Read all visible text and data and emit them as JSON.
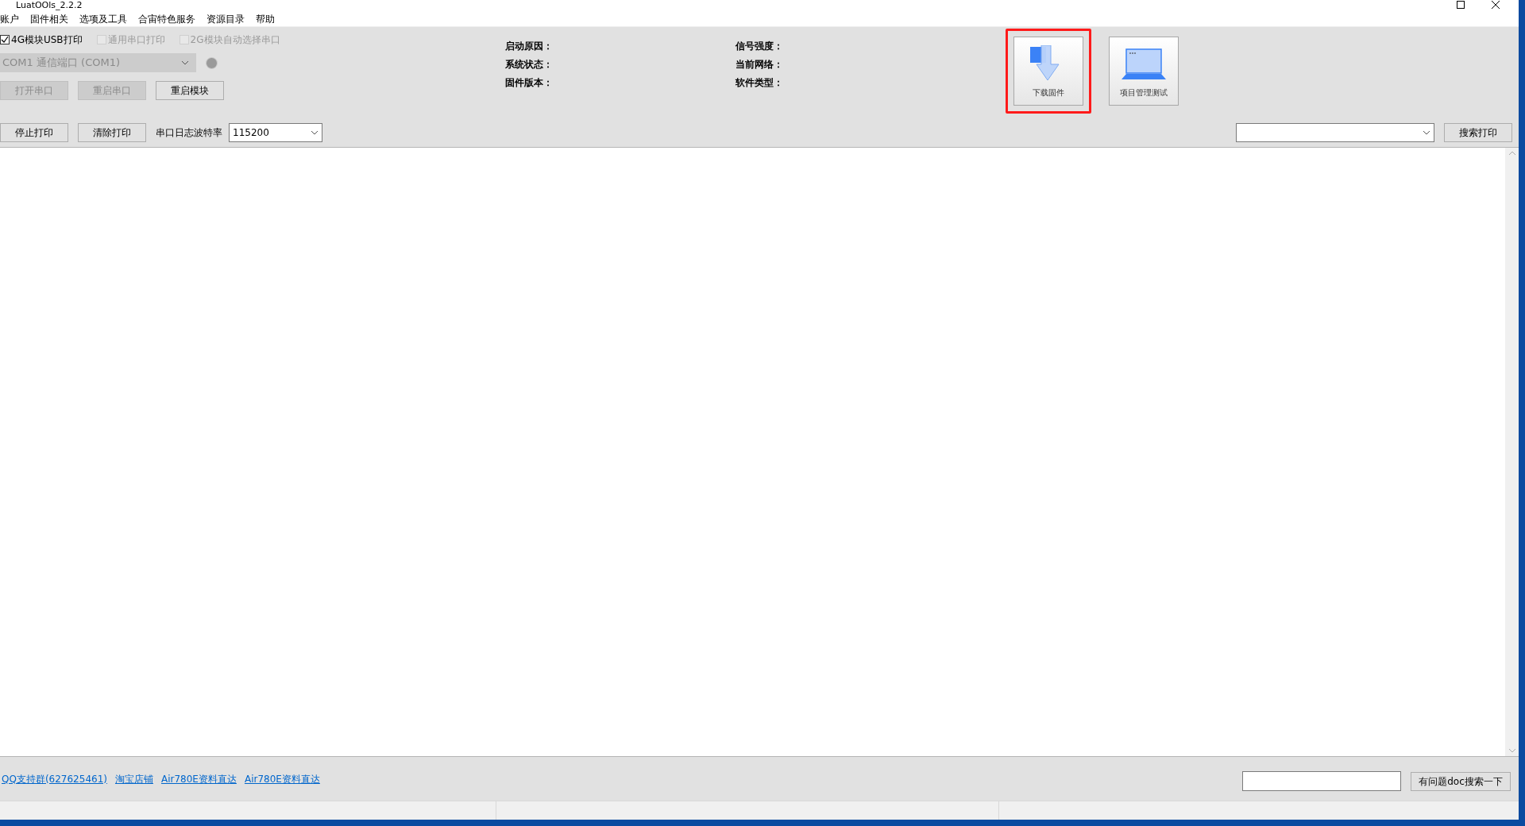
{
  "window": {
    "title": "LuatOOls_2.2.2"
  },
  "menu": [
    "账户",
    "固件相关",
    "选项及工具",
    "合宙特色服务",
    "资源目录",
    "帮助"
  ],
  "options": [
    {
      "label": "4G模块USB打印",
      "checked": true,
      "disabled": false
    },
    {
      "label": "通用串口打印",
      "checked": false,
      "disabled": true
    },
    {
      "label": "2G模块自动选择串口",
      "checked": false,
      "disabled": true
    }
  ],
  "port": {
    "value": "COM1 通信端口 (COM1)",
    "disabled": true
  },
  "port_buttons": [
    {
      "label": "打开串口",
      "disabled": true
    },
    {
      "label": "重启串口",
      "disabled": true
    },
    {
      "label": "重启模块",
      "disabled": false
    }
  ],
  "info": [
    [
      "启动原因：",
      "系统状态：",
      "固件版本："
    ],
    [
      "信号强度：",
      "当前网络：",
      "软件类型："
    ]
  ],
  "tools": [
    {
      "kind": "download",
      "label": "下载固件",
      "highlighted": true
    },
    {
      "kind": "laptop",
      "label": "项目管理测试",
      "highlighted": false
    }
  ],
  "log_buttons": [
    "停止打印",
    "清除打印"
  ],
  "baud": {
    "label": "串口日志波特率",
    "value": "115200"
  },
  "search_button": "搜索打印",
  "links": [
    "QQ支持群(627625461)",
    "淘宝店铺",
    "Air780E资料直达",
    "Air780E资料直达"
  ],
  "doc_button": "有问题doc搜索一下"
}
